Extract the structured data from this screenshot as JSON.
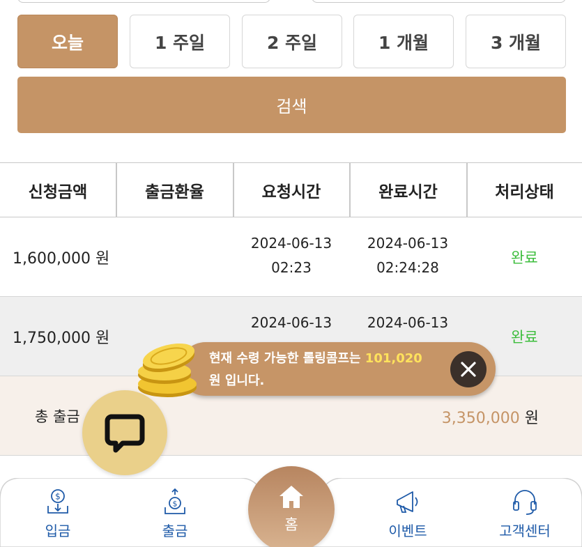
{
  "period_buttons": [
    {
      "label": "오늘",
      "active": true
    },
    {
      "label": "1 주일",
      "active": false
    },
    {
      "label": "2 주일",
      "active": false
    },
    {
      "label": "1 개월",
      "active": false
    },
    {
      "label": "3 개월",
      "active": false
    }
  ],
  "search_label": "검색",
  "table": {
    "headers": [
      "신청금액",
      "출금환율",
      "요청시간",
      "완료시간",
      "처리상태"
    ],
    "rows": [
      {
        "amount": "1,600,000 원",
        "rate": "",
        "request_date": "2024-06-13",
        "request_time": "02:23",
        "complete_date": "2024-06-13",
        "complete_time": "02:24:28",
        "status": "완료"
      },
      {
        "amount": "1,750,000 원",
        "rate": "",
        "request_date": "2024-06-13",
        "request_time": "",
        "complete_date": "2024-06-13",
        "complete_time": "",
        "status": "완료"
      }
    ],
    "total_label": "총 출금",
    "total_value": "3,350,000",
    "total_unit": " 원"
  },
  "toast": {
    "text_before": "현재 수령 가능한 롤링콤프는 ",
    "highlight": "101,020",
    "text_after": "원 입니다."
  },
  "bottom_nav": {
    "deposit": "입금",
    "withdraw": "출금",
    "home": "홈",
    "event": "이벤트",
    "support": "고객센터"
  },
  "colors": {
    "accent": "#c59466",
    "status_done": "#3cbd3c",
    "nav_text": "#1e5aa8",
    "toast_highlight": "#ffe25c"
  },
  "icons": [
    "close-icon",
    "chat-icon",
    "deposit-icon",
    "withdraw-icon",
    "home-icon",
    "megaphone-icon",
    "headset-icon",
    "coins-icon"
  ]
}
